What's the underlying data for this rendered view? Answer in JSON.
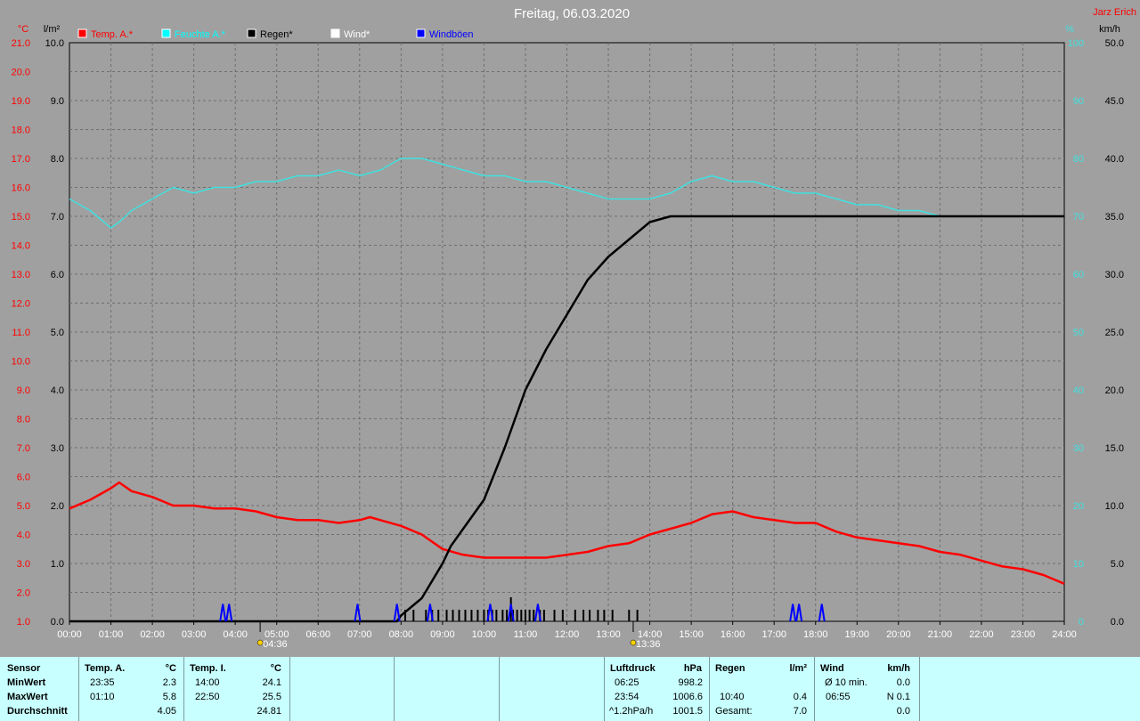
{
  "header": {
    "title": "Freitag, 06.03.2020",
    "author": "Jarz Erich",
    "unit_temp": "°C",
    "unit_rain": "l/m²",
    "unit_humidity": "%",
    "unit_wind": "km/h"
  },
  "legend": [
    {
      "label": "Temp. A.*",
      "color": "#ff0000"
    },
    {
      "label": "Feuchte A.*",
      "color": "#00ffff"
    },
    {
      "label": "Regen*",
      "color": "#000000"
    },
    {
      "label": "Wind*",
      "color": "#ffffff"
    },
    {
      "label": "Windböen",
      "color": "#0000ff"
    }
  ],
  "axes": {
    "x_ticks": [
      "00:00",
      "01:00",
      "02:00",
      "03:00",
      "04:00",
      "05:00",
      "06:00",
      "07:00",
      "08:00",
      "09:00",
      "10:00",
      "11:00",
      "12:00",
      "13:00",
      "14:00",
      "15:00",
      "16:00",
      "17:00",
      "18:00",
      "19:00",
      "20:00",
      "21:00",
      "22:00",
      "23:00",
      "24:00"
    ],
    "temp_ticks": [
      "1.0",
      "2.0",
      "3.0",
      "4.0",
      "5.0",
      "6.0",
      "7.0",
      "8.0",
      "9.0",
      "10.0",
      "11.0",
      "12.0",
      "13.0",
      "14.0",
      "15.0",
      "16.0",
      "17.0",
      "18.0",
      "19.0",
      "20.0",
      "21.0"
    ],
    "rain_ticks": [
      "0.0",
      "1.0",
      "2.0",
      "3.0",
      "4.0",
      "5.0",
      "6.0",
      "7.0",
      "8.0",
      "9.0",
      "10.0"
    ],
    "humidity_ticks": [
      "0",
      "10",
      "20",
      "30",
      "40",
      "50",
      "60",
      "70",
      "80",
      "90",
      "100"
    ],
    "wind_ticks": [
      "0.0",
      "5.0",
      "10.0",
      "15.0",
      "20.0",
      "25.0",
      "30.0",
      "35.0",
      "40.0",
      "45.0",
      "50.0"
    ],
    "sunrise": "04:36",
    "sunset": "13:36"
  },
  "chart_data": {
    "type": "line",
    "title": "Freitag, 06.03.2020",
    "x_range": [
      0,
      24
    ],
    "series": [
      {
        "name": "Temp. A.*",
        "axis": "temp",
        "color": "#ff0000",
        "ylim": [
          1,
          21
        ],
        "x": [
          0,
          0.5,
          1.0,
          1.2,
          1.5,
          2.0,
          2.5,
          3.0,
          3.5,
          4.0,
          4.5,
          5.0,
          5.5,
          6.0,
          6.5,
          7.0,
          7.25,
          7.5,
          8.0,
          8.5,
          9.0,
          9.5,
          10.0,
          10.5,
          11.0,
          11.5,
          12.0,
          12.5,
          13.0,
          13.5,
          14.0,
          14.5,
          15.0,
          15.5,
          16.0,
          16.5,
          17.0,
          17.5,
          18.0,
          18.5,
          19.0,
          19.5,
          20.0,
          20.5,
          21.0,
          21.5,
          22.0,
          22.5,
          23.0,
          23.5,
          24.0
        ],
        "y": [
          4.9,
          5.2,
          5.6,
          5.8,
          5.5,
          5.3,
          5.0,
          5.0,
          4.9,
          4.9,
          4.8,
          4.6,
          4.5,
          4.5,
          4.4,
          4.5,
          4.6,
          4.5,
          4.3,
          4.0,
          3.5,
          3.3,
          3.2,
          3.2,
          3.2,
          3.2,
          3.3,
          3.4,
          3.6,
          3.7,
          4.0,
          4.2,
          4.4,
          4.7,
          4.8,
          4.6,
          4.5,
          4.4,
          4.4,
          4.1,
          3.9,
          3.8,
          3.7,
          3.6,
          3.4,
          3.3,
          3.1,
          2.9,
          2.8,
          2.6,
          2.3
        ]
      },
      {
        "name": "Feuchte A.*",
        "axis": "humidity",
        "color": "#40e0e0",
        "ylim": [
          0,
          100
        ],
        "x": [
          0,
          0.5,
          1.0,
          1.2,
          1.5,
          2.0,
          2.5,
          3.0,
          3.5,
          4.0,
          4.5,
          5.0,
          5.5,
          6.0,
          6.5,
          7.0,
          7.5,
          8.0,
          8.5,
          9.0,
          9.5,
          10.0,
          10.5,
          11.0,
          11.5,
          12.0,
          12.5,
          13.0,
          13.5,
          14.0,
          14.5,
          15.0,
          15.5,
          16.0,
          16.5,
          17.0,
          17.5,
          18.0,
          18.5,
          19.0,
          19.5,
          20.0,
          20.5,
          21.0,
          21.5,
          22.0,
          22.5,
          23.0,
          23.5,
          24.0
        ],
        "y": [
          73,
          71,
          68,
          69,
          71,
          73,
          75,
          74,
          75,
          75,
          76,
          76,
          77,
          77,
          78,
          77,
          78,
          80,
          80,
          79,
          78,
          77,
          77,
          76,
          76,
          75,
          74,
          73,
          73,
          73,
          74,
          76,
          77,
          76,
          76,
          75,
          74,
          74,
          73,
          72,
          72,
          71,
          71,
          70,
          70,
          70,
          70,
          70,
          70,
          70
        ]
      },
      {
        "name": "Regen*",
        "axis": "rain",
        "color": "#000000",
        "ylim": [
          0,
          10
        ],
        "x": [
          0,
          7.9,
          8.0,
          8.5,
          9.0,
          9.2,
          9.5,
          10.0,
          10.5,
          11.0,
          11.5,
          12.0,
          12.5,
          13.0,
          13.5,
          14.0,
          14.5,
          15.0,
          24.0
        ],
        "y": [
          0,
          0,
          0.1,
          0.4,
          1.0,
          1.3,
          1.6,
          2.1,
          3.0,
          4.0,
          4.7,
          5.3,
          5.9,
          6.3,
          6.6,
          6.9,
          7.0,
          7.0,
          7.0
        ]
      },
      {
        "name": "Windböen",
        "axis": "wind",
        "color": "#0000ff",
        "ylim": [
          0,
          50
        ],
        "spikes": [
          3.7,
          3.85,
          6.95,
          7.9,
          8.7,
          10.15,
          10.65,
          11.3,
          17.45,
          17.6,
          18.15
        ],
        "spike_value": 1.5
      }
    ]
  },
  "rain_bars": {
    "hours": [
      8.1,
      8.3,
      8.6,
      8.75,
      8.9,
      9.1,
      9.25,
      9.4,
      9.55,
      9.7,
      9.85,
      10.0,
      10.1,
      10.2,
      10.3,
      10.45,
      10.55,
      10.7,
      10.8,
      10.9,
      11.0,
      11.1,
      11.2,
      11.35,
      11.45,
      11.7,
      11.9,
      12.2,
      12.4,
      12.55,
      12.75,
      12.9,
      13.1,
      13.5,
      13.7
    ],
    "tall_hour": 10.65
  },
  "info": {
    "c1": {
      "h": "Sensor",
      "r1": "MinWert",
      "r2": "MaxWert",
      "r3": "Durchschnitt"
    },
    "c2": {
      "h": "Temp. A.",
      "u": "°C",
      "t1": "23:35",
      "v1": "2.3",
      "t2": "01:10",
      "v2": "5.8",
      "v3": "4.05"
    },
    "c3": {
      "h": "Temp. I.",
      "u": "°C",
      "t1": "14:00",
      "v1": "24.1",
      "t2": "22:50",
      "v2": "25.5",
      "v3": "24.81"
    },
    "c4": {
      "h": "Luftdruck",
      "u": "hPa",
      "t1": "06:25",
      "v1": "998.2",
      "t2": "23:54",
      "v2": "1006.6",
      "t3": "^1.2hPa/h",
      "v3": "1001.5"
    },
    "c5": {
      "h": "Regen",
      "u": "l/m²",
      "t2": "10:40",
      "v2": "0.4",
      "t3": "Gesamt:",
      "v3": "7.0"
    },
    "c6": {
      "h": "Wind",
      "u": "km/h",
      "t1": "Ø 10 min.",
      "v1": "0.0",
      "t2": "06:55",
      "v2": "N 0.1",
      "v3": "0.0"
    }
  }
}
